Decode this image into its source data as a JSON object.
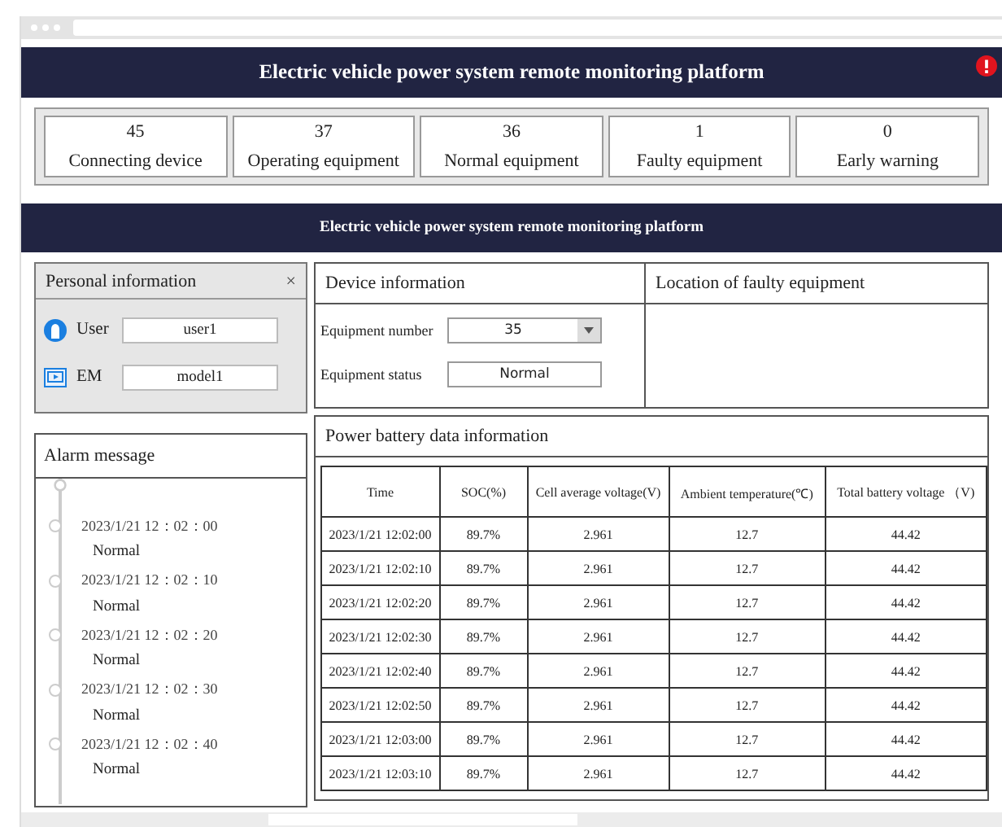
{
  "header": {
    "title": "Electric vehicle power system remote monitoring platform"
  },
  "stats": [
    {
      "value": "45",
      "label": "Connecting device"
    },
    {
      "value": "37",
      "label": "Operating equipment"
    },
    {
      "value": "36",
      "label": "Normal equipment"
    },
    {
      "value": "1",
      "label": "Faulty equipment"
    },
    {
      "value": "0",
      "label": "Early warning"
    }
  ],
  "banner": {
    "title": "Electric vehicle power system remote monitoring platform"
  },
  "personal_info": {
    "title": "Personal information",
    "close": "×",
    "fields": [
      {
        "kind": "user",
        "label": "User",
        "value": "user1"
      },
      {
        "kind": "em",
        "label": "EM",
        "value": "model1"
      }
    ]
  },
  "alarm": {
    "title": "Alarm message",
    "entries": [
      {
        "time": "2023/1/21 12：02：00",
        "status": "Normal"
      },
      {
        "time": "2023/1/21 12：02：10",
        "status": "Normal"
      },
      {
        "time": "2023/1/21 12：02：20",
        "status": "Normal"
      },
      {
        "time": "2023/1/21 12：02：30",
        "status": "Normal"
      },
      {
        "time": "2023/1/21 12：02：40",
        "status": "Normal"
      }
    ]
  },
  "device_info": {
    "title": "Device information",
    "fields": [
      {
        "kind": "dropdown",
        "label": "Equipment number",
        "value": "35"
      },
      {
        "kind": "text",
        "label": "Equipment status",
        "value": "Normal"
      }
    ]
  },
  "fault_location": {
    "title": "Location of faulty equipment"
  },
  "battery": {
    "title": "Power battery data information",
    "table": {
      "columns": [
        "Time",
        "SOC(%)",
        "Cell average voltage(V)",
        "Ambient temperature(℃)",
        "Total battery voltage （V)"
      ],
      "rows": [
        [
          "2023/1/21 12:02:00",
          "89.7%",
          "2.961",
          "12.7",
          "44.42"
        ],
        [
          "2023/1/21 12:02:10",
          "89.7%",
          "2.961",
          "12.7",
          "44.42"
        ],
        [
          "2023/1/21 12:02:20",
          "89.7%",
          "2.961",
          "12.7",
          "44.42"
        ],
        [
          "2023/1/21 12:02:30",
          "89.7%",
          "2.961",
          "12.7",
          "44.42"
        ],
        [
          "2023/1/21 12:02:40",
          "89.7%",
          "2.961",
          "12.7",
          "44.42"
        ],
        [
          "2023/1/21 12:02:50",
          "89.7%",
          "2.961",
          "12.7",
          "44.42"
        ],
        [
          "2023/1/21 12:03:00",
          "89.7%",
          "2.961",
          "12.7",
          "44.42"
        ],
        [
          "2023/1/21 12:03:10",
          "89.7%",
          "2.961",
          "12.7",
          "44.42"
        ]
      ]
    }
  }
}
